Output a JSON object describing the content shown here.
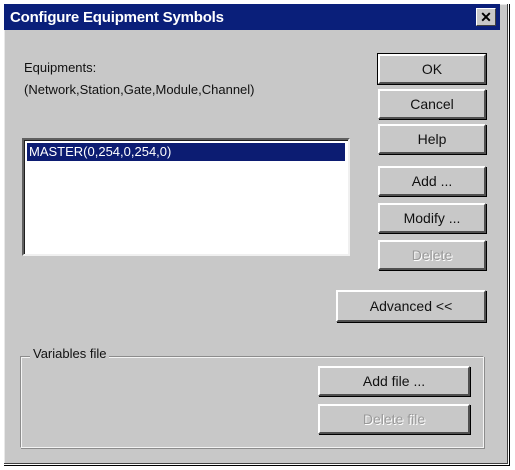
{
  "dialog": {
    "title": "Configure Equipment Symbols",
    "equipments_label": "Equipments:",
    "equipments_format": "(Network,Station,Gate,Module,Channel)"
  },
  "equipment_list": {
    "items": [
      "MASTER(0,254,0,254,0)"
    ],
    "selected_index": 0
  },
  "buttons": {
    "ok": "OK",
    "cancel": "Cancel",
    "help": "Help",
    "add": "Add ...",
    "modify": "Modify ...",
    "delete": "Delete",
    "advanced": "Advanced <<"
  },
  "variables_file": {
    "group_label": "Variables file",
    "add_file": "Add file ...",
    "delete_file": "Delete file"
  },
  "colors": {
    "titlebar": "#0a1f7a",
    "selection": "#0c1c72",
    "face": "#c8c8c8"
  }
}
